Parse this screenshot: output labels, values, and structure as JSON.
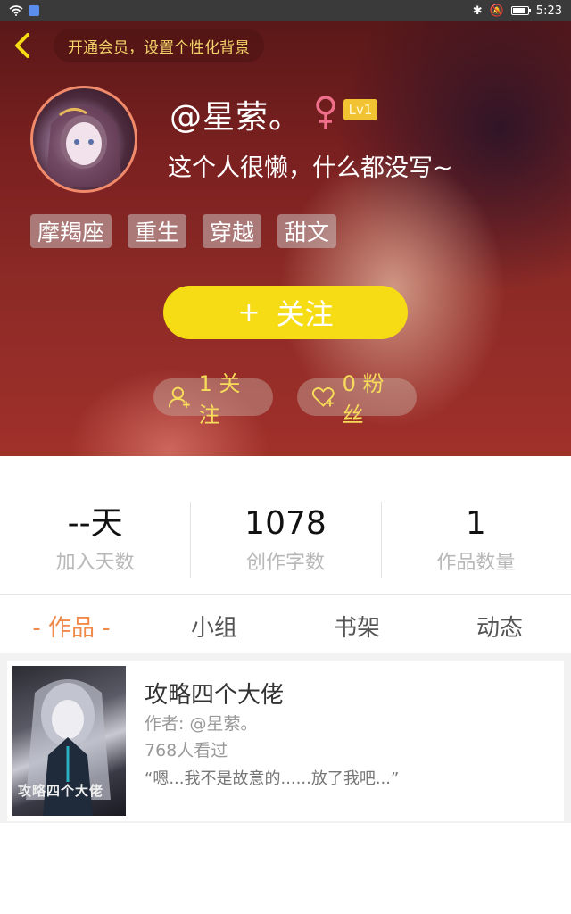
{
  "status_bar": {
    "time": "5:23"
  },
  "header": {
    "vip_text": "开通会员，设置个性化背景",
    "username": "@星萦。",
    "level": "Lv1",
    "bio": "这个人很懒，什么都没写~",
    "tags": [
      "摩羯座",
      "重生",
      "穿越",
      "甜文"
    ],
    "follow_button": {
      "plus": "+",
      "label": "关注"
    },
    "following_text": "1 关注",
    "fans_text": "0 粉丝"
  },
  "stats": [
    {
      "value": "--天",
      "label": "加入天数"
    },
    {
      "value": "1078",
      "label": "创作字数"
    },
    {
      "value": "1",
      "label": "作品数量"
    }
  ],
  "tabs": [
    "- 作品 -",
    "小组",
    "书架",
    "动态"
  ],
  "works": [
    {
      "cover_text": "攻略四个大佬",
      "title": "攻略四个大佬",
      "author": "作者: @星萦。",
      "views": "768人看过",
      "excerpt": "“嗯...我不是故意的......放了我吧...”"
    }
  ],
  "colors": {
    "accent_yellow": "#f6dc14",
    "active_tab": "#f08a4a",
    "level_badge": "#f1c232"
  }
}
